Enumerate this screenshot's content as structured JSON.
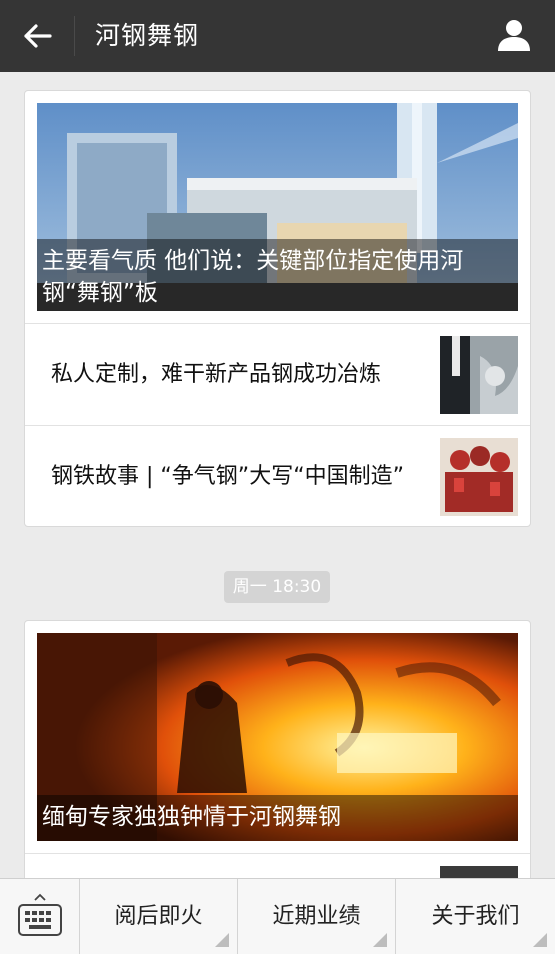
{
  "header": {
    "title": "河钢舞钢"
  },
  "feed": {
    "group1": {
      "hero": {
        "title": "主要看气质 他们说：关键部位指定使用河钢“舞钢”板"
      },
      "items": [
        {
          "title": "私人定制，难干新产品钢成功冶炼"
        },
        {
          "title": "钢铁故事 | “争气钢”大写“中国制造”"
        }
      ]
    },
    "timestamp": "周一 18:30",
    "group2": {
      "hero": {
        "title": "缅甸专家独独钟情于河钢舞钢"
      }
    }
  },
  "bottom_menu": [
    {
      "label": "阅后即火"
    },
    {
      "label": "近期业绩"
    },
    {
      "label": "关于我们"
    }
  ],
  "colors": {
    "topbar": "#353535",
    "background": "#ebebeb",
    "timestamp_badge": "#d4d4d4"
  }
}
